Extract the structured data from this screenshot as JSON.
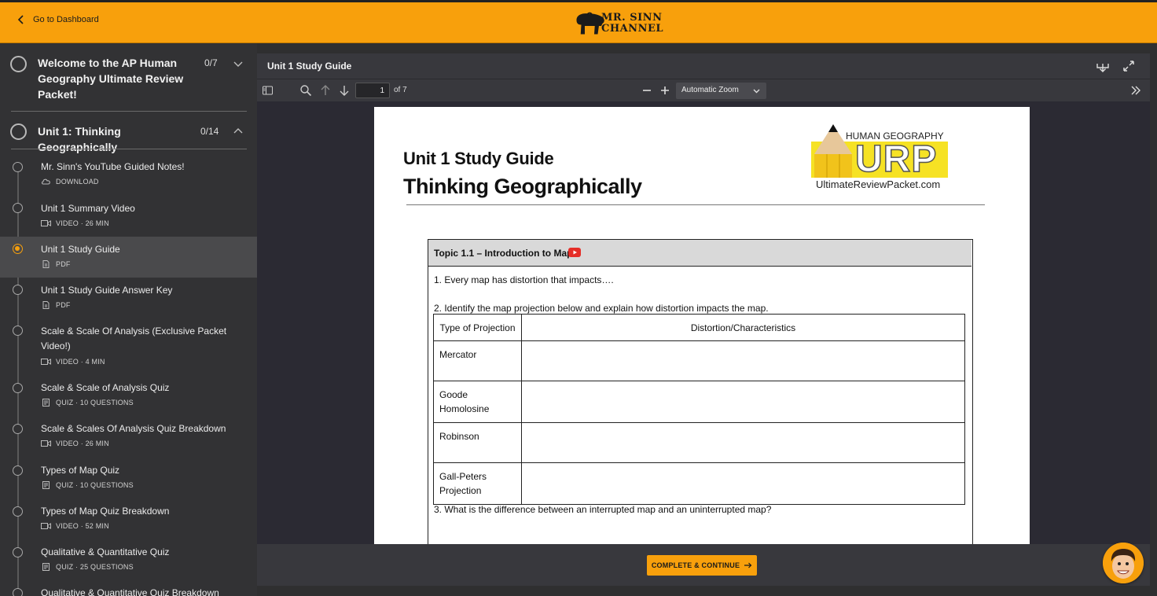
{
  "header": {
    "back_label": "Go to Dashboard",
    "logo_line1": "MR. SINN",
    "logo_line2": "CHANNEL"
  },
  "sidebar": {
    "sections": [
      {
        "title": "Welcome to the AP Human Geography Ultimate Review Packet!",
        "count": "0/7",
        "expanded": false
      },
      {
        "title": "Unit 1: Thinking Geographically",
        "count": "0/14",
        "expanded": true
      }
    ],
    "lessons": [
      {
        "title": "Mr. Sinn's YouTube Guided Notes!",
        "meta": "DOWNLOAD",
        "icon": "cloud-download-icon"
      },
      {
        "title": "Unit 1 Summary Video",
        "meta": "VIDEO · 26 MIN",
        "icon": "video-icon"
      },
      {
        "title": "Unit 1 Study Guide",
        "meta": "PDF",
        "icon": "pdf-icon",
        "active": true
      },
      {
        "title": "Unit 1 Study Guide Answer Key",
        "meta": "PDF",
        "icon": "pdf-icon"
      },
      {
        "title": "Scale & Scale Of Analysis (Exclusive Packet Video!)",
        "meta": "VIDEO · 4 MIN",
        "icon": "video-icon"
      },
      {
        "title": "Scale & Scale of Analysis Quiz",
        "meta": "QUIZ · 10 QUESTIONS",
        "icon": "quiz-icon"
      },
      {
        "title": "Scale & Scales Of Analysis Quiz Breakdown",
        "meta": "VIDEO · 26 MIN",
        "icon": "video-icon"
      },
      {
        "title": "Types of Map Quiz",
        "meta": "QUIZ · 10 QUESTIONS",
        "icon": "quiz-icon"
      },
      {
        "title": "Types of Map Quiz Breakdown",
        "meta": "VIDEO · 52 MIN",
        "icon": "video-icon"
      },
      {
        "title": "Qualitative & Quantitative Quiz",
        "meta": "QUIZ · 25 QUESTIONS",
        "icon": "quiz-icon"
      },
      {
        "title": "Qualitative & Quantitative Quiz Breakdown",
        "meta": "",
        "icon": ""
      }
    ]
  },
  "viewer": {
    "title": "Unit 1 Study Guide",
    "page_number": "1",
    "page_total": "of 7",
    "zoom": "Automatic Zoom"
  },
  "document": {
    "heading1": "Unit 1 Study Guide",
    "heading2": "Thinking Geographically",
    "logo_top": "HUMAN GEOGRAPHY",
    "logo_letters": "URP",
    "logo_url": "UltimateReviewPacket.com",
    "topic_title": "Topic 1.1 – Introduction to Maps",
    "q1": "1. Every map has distortion that impacts….",
    "q2": "2. Identify the map projection below and explain how distortion impacts the map.",
    "q3": "3. What is the difference between an interrupted map and an uninterrupted map?",
    "table_headers": [
      "Type of Projection",
      "Distortion/Characteristics"
    ],
    "table_rows": [
      "Mercator",
      "Goode Homolosine",
      "Robinson",
      "Gall-Peters Projection"
    ]
  },
  "footer": {
    "cta_label": "COMPLETE & CONTINUE"
  },
  "colors": {
    "accent": "#f8a00c",
    "sidebar_bg": "#323234",
    "viewer_bg": "#38383d"
  }
}
